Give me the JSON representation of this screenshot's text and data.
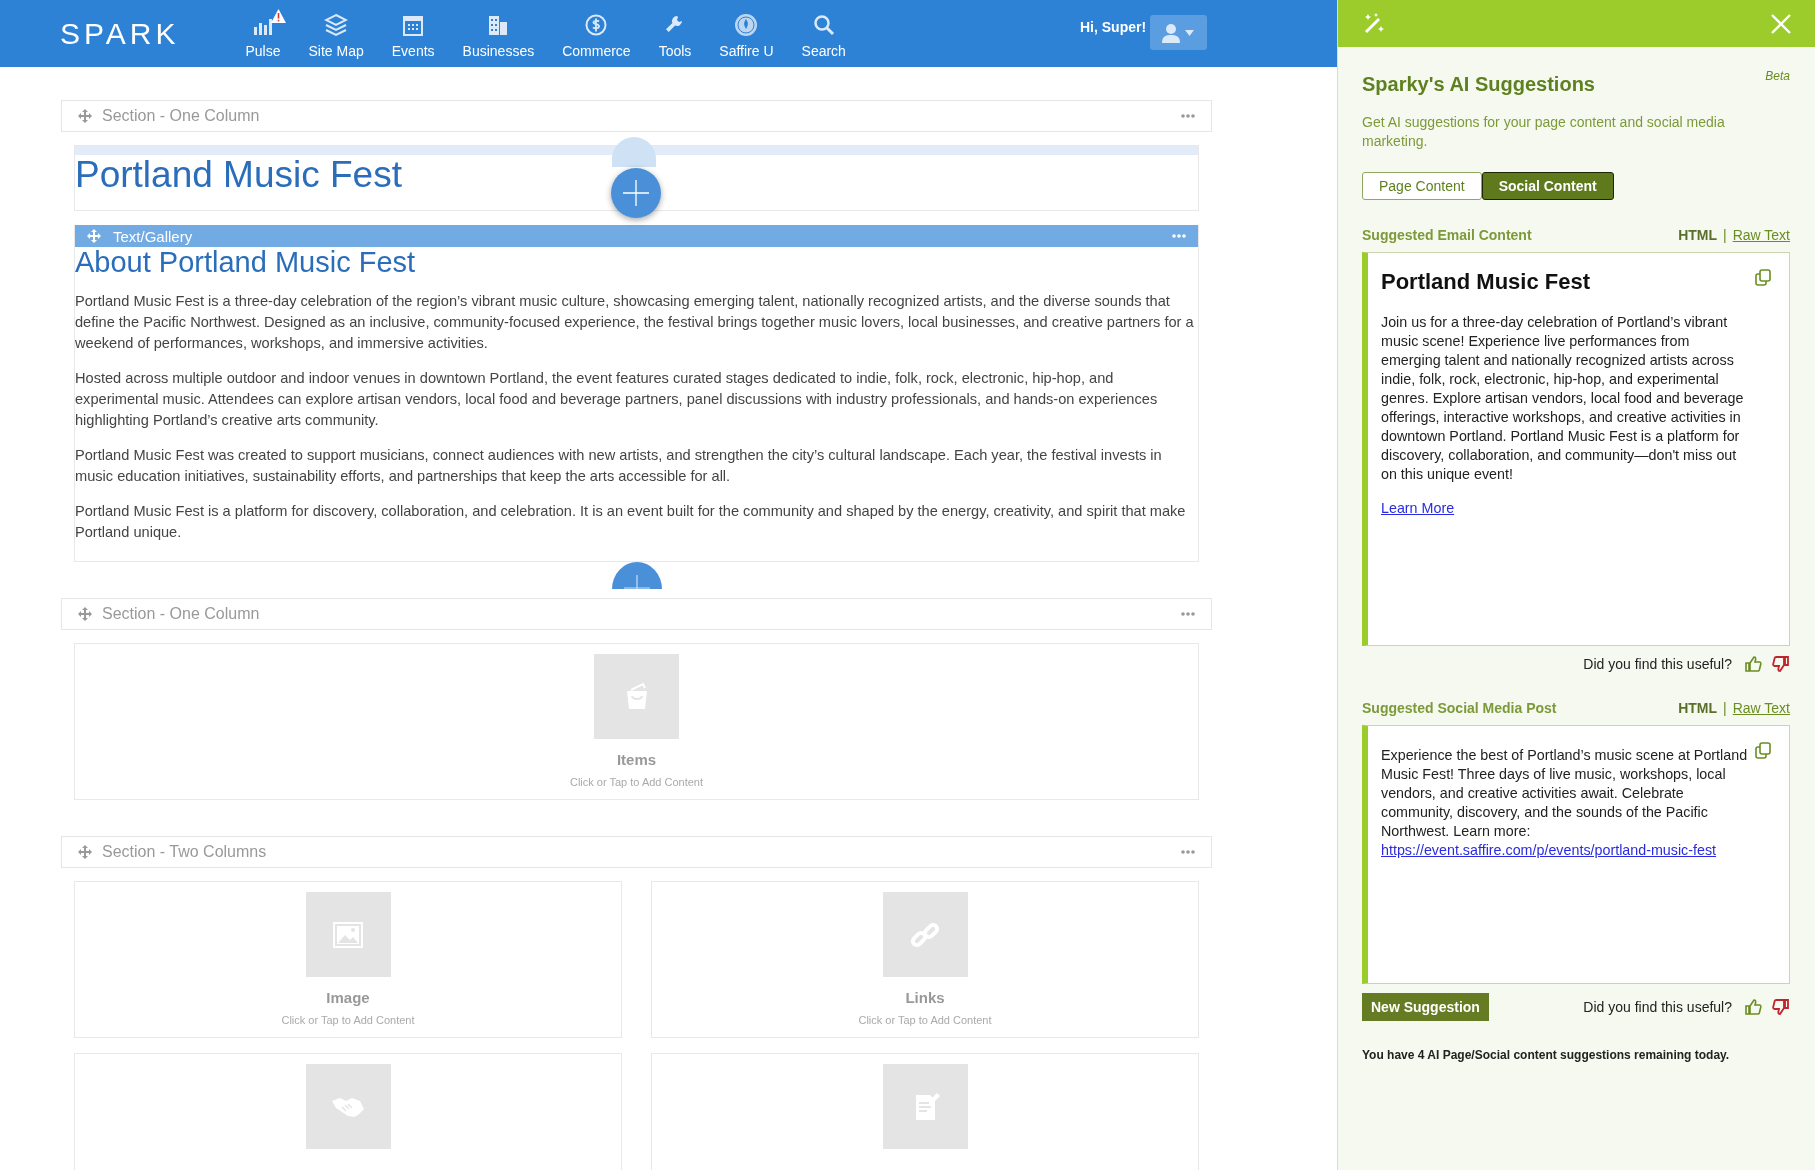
{
  "nav": {
    "logo": "SPARK",
    "items": [
      {
        "label": "Pulse",
        "alert": true
      },
      {
        "label": "Site Map",
        "alert": false
      },
      {
        "label": "Events",
        "alert": false
      },
      {
        "label": "Businesses",
        "alert": false
      },
      {
        "label": "Commerce",
        "alert": false
      },
      {
        "label": "Tools",
        "alert": false
      },
      {
        "label": "Saffire U",
        "alert": false
      },
      {
        "label": "Search",
        "alert": false
      }
    ],
    "greeting": "Hi, Super!"
  },
  "canvas": {
    "sections": [
      {
        "title": "Section - One Column",
        "blocks": [
          {
            "kind": "title",
            "heading": "Portland Music Fest"
          },
          {
            "kind": "text",
            "toolbar": "Text/Gallery",
            "heading": "About Portland Music Fest",
            "paragraphs": [
              "Portland Music Fest is a three-day celebration of the region’s vibrant music culture, showcasing emerging talent, nationally recognized artists, and the diverse sounds that define the Pacific Northwest. Designed as an inclusive, community-focused experience, the festival brings together music lovers, local businesses, and creative partners for a weekend of performances, workshops, and immersive activities.",
              "Hosted across multiple outdoor and indoor venues in downtown Portland, the event features curated stages dedicated to indie, folk, rock, electronic, hip-hop, and experimental music. Attendees can explore artisan vendors, local food and beverage partners, panel discussions with industry professionals, and hands-on experiences highlighting Portland’s creative arts community.",
              "Portland Music Fest was created to support musicians, connect audiences with new artists, and strengthen the city’s cultural landscape. Each year, the festival invests in music education initiatives, sustainability efforts, and partnerships that keep the arts accessible for all.",
              "Portland Music Fest is a platform for discovery, collaboration, and celebration. It is an event built for the community and shaped by the energy, creativity, and spirit that make Portland unique."
            ]
          }
        ]
      },
      {
        "title": "Section - One Column",
        "blocks": [
          {
            "kind": "onecol",
            "widgets": [
              {
                "kind": "widget",
                "label": "Items",
                "hint": "Click or Tap to Add Content"
              }
            ]
          }
        ]
      },
      {
        "title": "Section - Two Columns",
        "blocks": [
          {
            "kind": "twocol",
            "widgets": [
              {
                "kind": "widget",
                "label": "Image",
                "hint": "Click or Tap to Add Content"
              },
              {
                "kind": "widget",
                "label": "Links",
                "hint": "Click or Tap to Add Content"
              },
              {
                "kind": "widget"
              },
              {
                "kind": "widget"
              }
            ]
          }
        ]
      }
    ]
  },
  "panel": {
    "title": "Sparky's AI Suggestions",
    "badge": "Beta",
    "description": "Get AI suggestions for your page content and social media marketing.",
    "tabs": [
      {
        "label": "Page Content",
        "selected": false
      },
      {
        "label": "Social Content",
        "selected": true
      }
    ],
    "suggestions": [
      {
        "kind": "email",
        "label": "Suggested Email Content",
        "formats": [
          {
            "label": "HTML",
            "selected": true
          },
          {
            "label": "Raw Text",
            "selected": false
          }
        ],
        "separator": "|",
        "heading": "Portland Music Fest",
        "body": "Join us for a three-day celebration of Portland’s vibrant music scene! Experience live performances from emerging talent and nationally recognized artists across indie, folk, rock, electronic, hip-hop, and experimental genres. Explore artisan vendors, local food and beverage offerings, interactive workshops, and creative activities in downtown Portland. Portland Music Fest is a platform for discovery, collaboration, and community—don't miss out on this unique event!",
        "link": "Learn More",
        "feedback": "Did you find this useful?"
      },
      {
        "kind": "social",
        "label": "Suggested Social Media Post",
        "formats": [
          {
            "label": "HTML",
            "selected": true
          },
          {
            "label": "Raw Text",
            "selected": false
          }
        ],
        "separator": "|",
        "body": "Experience the best of Portland’s music scene at Portland Music Fest! Three days of live music, workshops, local vendors, and creative activities await. Celebrate community, discovery, and the sounds of the Pacific Northwest. Learn more:",
        "link": "https://event.saffire.com/p/events/portland-music-fest",
        "feedback": "Did you find this useful?"
      }
    ],
    "new_button": "New Suggestion",
    "note": "You have 4 AI Page/Social content suggestions remaining today."
  }
}
